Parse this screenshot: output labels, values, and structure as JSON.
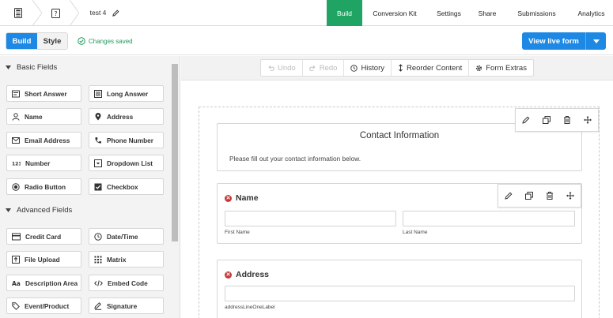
{
  "topbar": {
    "form_title": "test 4",
    "tabs": [
      {
        "label": "Build",
        "active": true
      },
      {
        "label": "Conversion Kit",
        "active": false
      },
      {
        "label": "Settings",
        "active": false
      },
      {
        "label": "Share",
        "active": false
      },
      {
        "label": "Submissions",
        "active": false
      },
      {
        "label": "Analytics",
        "active": false
      }
    ]
  },
  "subbar": {
    "build_label": "Build",
    "style_label": "Style",
    "saved_text": "Changes saved",
    "live_label": "View live form"
  },
  "sidebar": {
    "basic_title": "Basic Fields",
    "advanced_title": "Advanced Fields",
    "basic_fields": [
      {
        "label": "Short Answer",
        "icon": "short-answer"
      },
      {
        "label": "Long Answer",
        "icon": "long-answer"
      },
      {
        "label": "Name",
        "icon": "person"
      },
      {
        "label": "Address",
        "icon": "location-pin"
      },
      {
        "label": "Email Address",
        "icon": "envelope"
      },
      {
        "label": "Phone Number",
        "icon": "phone"
      },
      {
        "label": "Number",
        "icon": "number-123"
      },
      {
        "label": "Dropdown List",
        "icon": "dropdown"
      },
      {
        "label": "Radio Button",
        "icon": "radio"
      },
      {
        "label": "Checkbox",
        "icon": "checkbox"
      }
    ],
    "advanced_fields": [
      {
        "label": "Credit Card",
        "icon": "credit-card"
      },
      {
        "label": "Date/Time",
        "icon": "clock"
      },
      {
        "label": "File Upload",
        "icon": "upload"
      },
      {
        "label": "Matrix",
        "icon": "grid"
      },
      {
        "label": "Description Area",
        "icon": "text-aa"
      },
      {
        "label": "Embed Code",
        "icon": "code"
      },
      {
        "label": "Event/Product",
        "icon": "tag"
      },
      {
        "label": "Signature",
        "icon": "pen"
      }
    ]
  },
  "toolbar": {
    "undo": "Undo",
    "redo": "Redo",
    "history": "History",
    "reorder": "Reorder Content",
    "extras": "Form Extras"
  },
  "form": {
    "section_title": "Contact Information",
    "section_desc": "Please fill out your contact information below.",
    "name_label": "Name",
    "first_name": "First Name",
    "last_name": "Last Name",
    "address_label": "Address",
    "address_line1": "addressLineOneLabel"
  },
  "colors": {
    "accent_green": "#1fa463",
    "primary_blue": "#1e88e5",
    "required_red": "#c43a3a"
  }
}
